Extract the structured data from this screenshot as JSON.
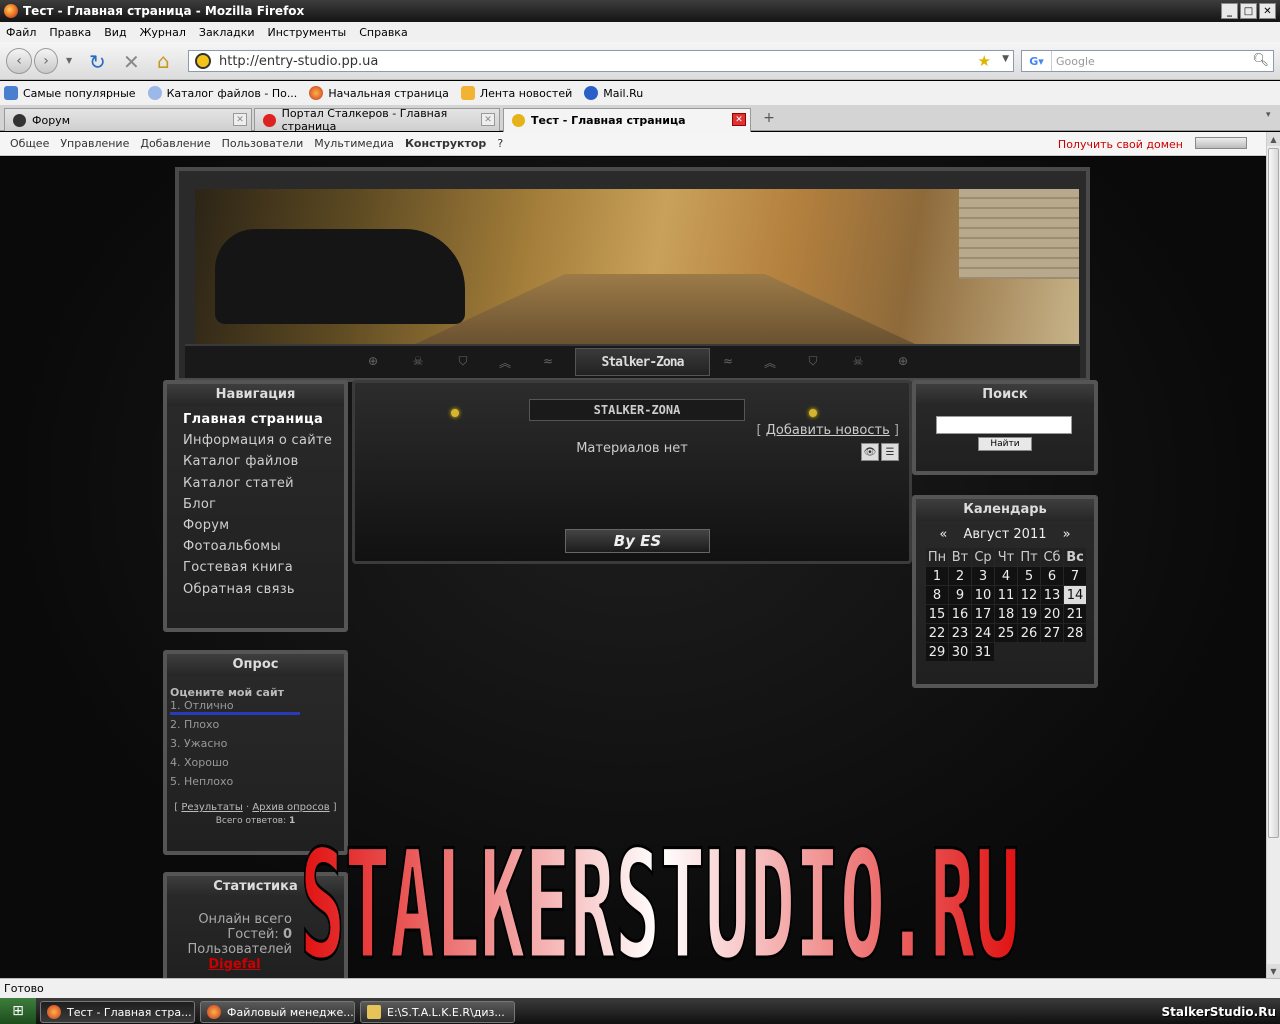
{
  "window": {
    "title": "Тест - Главная страница - Mozilla Firefox"
  },
  "menu": [
    "Файл",
    "Правка",
    "Вид",
    "Журнал",
    "Закладки",
    "Инструменты",
    "Справка"
  ],
  "address": {
    "url": "http://entry-studio.pp.ua",
    "search_placeholder": "Google"
  },
  "bookmarks": [
    {
      "label": "Самые популярные",
      "icon": "folder-icon"
    },
    {
      "label": "Каталог файлов - По...",
      "icon": "page-icon"
    },
    {
      "label": "Начальная страница",
      "icon": "firefox-icon"
    },
    {
      "label": "Лента новостей",
      "icon": "rss-folder-icon"
    },
    {
      "label": "Mail.Ru",
      "icon": "mail-icon"
    }
  ],
  "tabs": [
    {
      "label": "Форум",
      "active": false
    },
    {
      "label": "Портал Сталкеров - Главная страница",
      "active": false
    },
    {
      "label": "Тест - Главная страница",
      "active": true
    }
  ],
  "ucoz_bar": {
    "items": [
      "Общее",
      "Управление",
      "Добавление",
      "Пользователи",
      "Мультимедиа",
      "Конструктор",
      "?"
    ],
    "bold_item": "Конструктор",
    "domain_link": "Получить свой домен"
  },
  "header": {
    "site_name": "Stalker-Zona"
  },
  "navigation": {
    "title": "Навигация",
    "items": [
      "Главная страница",
      "Информация о сайте",
      "Каталог файлов",
      "Каталог статей",
      "Блог",
      "Форум",
      "Фотоальбомы",
      "Гостевая книга",
      "Обратная связь"
    ]
  },
  "poll": {
    "title": "Опрос",
    "question": "Оцените мой сайт",
    "options": [
      {
        "label": "1. Отлично",
        "share": 1.0
      },
      {
        "label": "2. Плохо",
        "share": 0
      },
      {
        "label": "3. Ужасно",
        "share": 0
      },
      {
        "label": "4. Хорошо",
        "share": 0
      },
      {
        "label": "5. Неплохо",
        "share": 0
      }
    ],
    "results_link": "Результаты",
    "archive_link": "Архив опросов",
    "total_label": "Всего ответов:",
    "total_value": "1"
  },
  "stats": {
    "title": "Статистика",
    "online_label": "Онлайн всего",
    "guests_label": "Гостей:",
    "guests_value": "0",
    "users_label": "Пользователей",
    "user_name": "Digefal"
  },
  "content": {
    "title": "STALKER-ZONA",
    "add_news_link": "Добавить новость",
    "empty_text": "Материалов нет",
    "footer_label": "By ES"
  },
  "search": {
    "title": "Поиск",
    "button": "Найти"
  },
  "calendar": {
    "title": "Календарь",
    "month": "Август 2011",
    "prev": "«",
    "next": "»",
    "day_names": [
      "Пн",
      "Вт",
      "Ср",
      "Чт",
      "Пт",
      "Сб",
      "Вс"
    ],
    "weeks": [
      [
        "1",
        "2",
        "3",
        "4",
        "5",
        "6",
        "7"
      ],
      [
        "8",
        "9",
        "10",
        "11",
        "12",
        "13",
        "14"
      ],
      [
        "15",
        "16",
        "17",
        "18",
        "19",
        "20",
        "21"
      ],
      [
        "22",
        "23",
        "24",
        "25",
        "26",
        "27",
        "28"
      ],
      [
        "29",
        "30",
        "31",
        "",
        "",
        "",
        ""
      ]
    ],
    "today": "14"
  },
  "watermark": "STALKERSTUDIO.RU",
  "status": "Готово",
  "taskbar": {
    "tasks": [
      "Тест - Главная стра...",
      "Файловый менедже...",
      "E:\\S.T.A.L.K.E.R\\диз..."
    ],
    "tray_text": "StalkerStudio.Ru"
  },
  "colors": {
    "accent_red": "#cc0000",
    "poll_bar": "#2a3ab8",
    "page_bg": "#0a0a0a"
  }
}
